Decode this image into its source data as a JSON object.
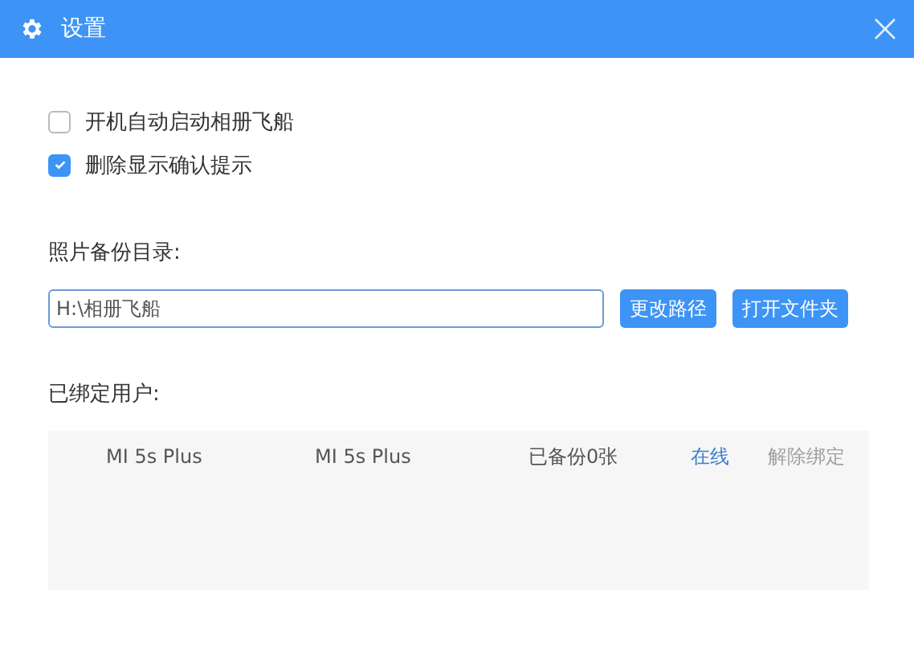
{
  "window": {
    "title": "设置"
  },
  "options": [
    {
      "label": "开机自动启动相册飞船",
      "checked": false
    },
    {
      "label": "删除显示确认提示",
      "checked": true
    }
  ],
  "backup_dir": {
    "label": "照片备份目录:",
    "value": "H:\\相册飞船",
    "buttons": [
      "更改路径",
      "打开文件夹"
    ]
  },
  "bound_users": {
    "label": "已绑定用户:",
    "rows": [
      {
        "device_name": "MI 5s Plus",
        "model": "MI 5s Plus",
        "backup_status": "已备份0张",
        "status": "在线",
        "online": true,
        "unbind": "解除绑定",
        "unbind_disabled": true
      }
    ]
  }
}
